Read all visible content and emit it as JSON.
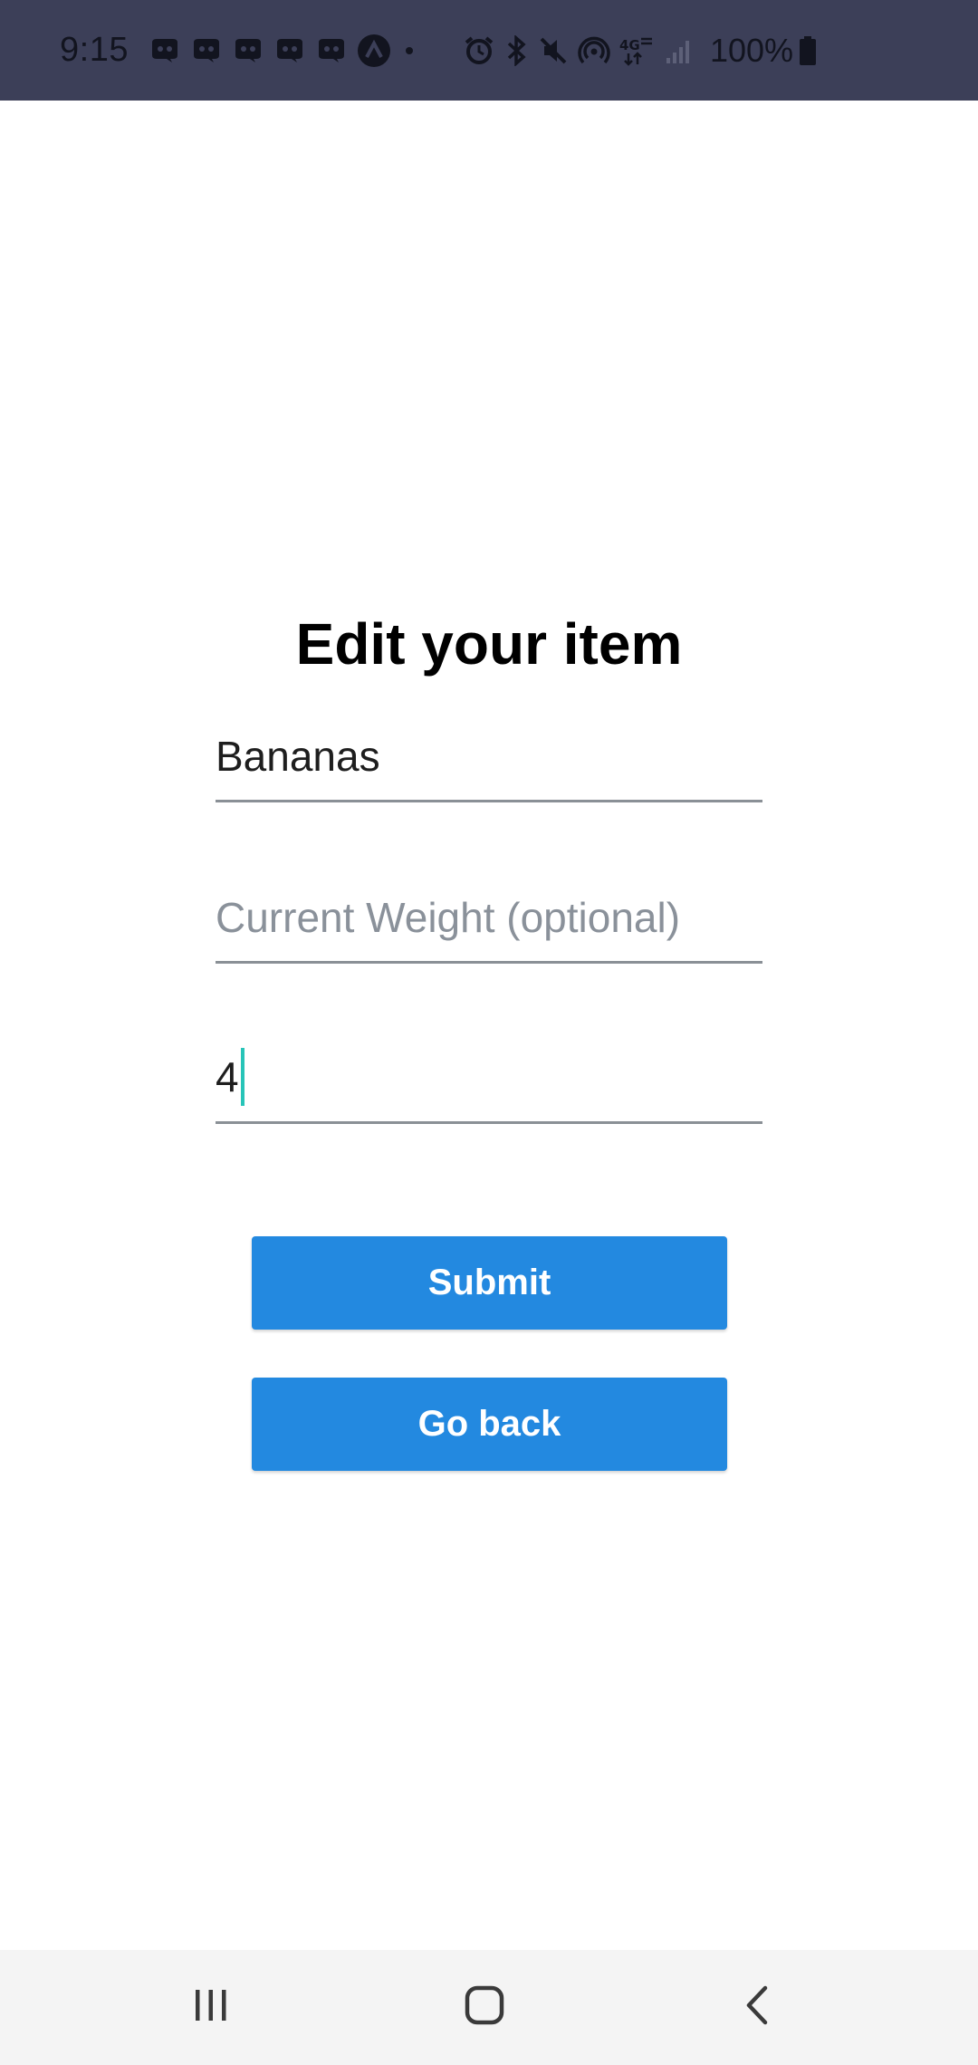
{
  "status_bar": {
    "time": "9:15",
    "notification_icons": [
      "discord-icon",
      "discord-icon",
      "discord-icon",
      "discord-icon",
      "discord-icon",
      "arc-app-icon",
      "dot-icon"
    ],
    "system_icons": [
      "alarm-icon",
      "bluetooth-icon",
      "mute-icon",
      "hotspot-icon",
      "lte-4g-icon",
      "signal-icon"
    ],
    "battery_percent": "100%",
    "background": "#3c3f58"
  },
  "form": {
    "title": "Edit your item",
    "name_value": "Bananas",
    "weight_placeholder": "Current Weight (optional)",
    "weight_value": "",
    "quantity_value": "4",
    "caret_color": "#27c4b8"
  },
  "buttons": {
    "submit_label": "Submit",
    "back_label": "Go back",
    "color": "#2389e0"
  },
  "nav_bar": {
    "items": [
      "recents-icon",
      "home-icon",
      "back-icon"
    ]
  }
}
